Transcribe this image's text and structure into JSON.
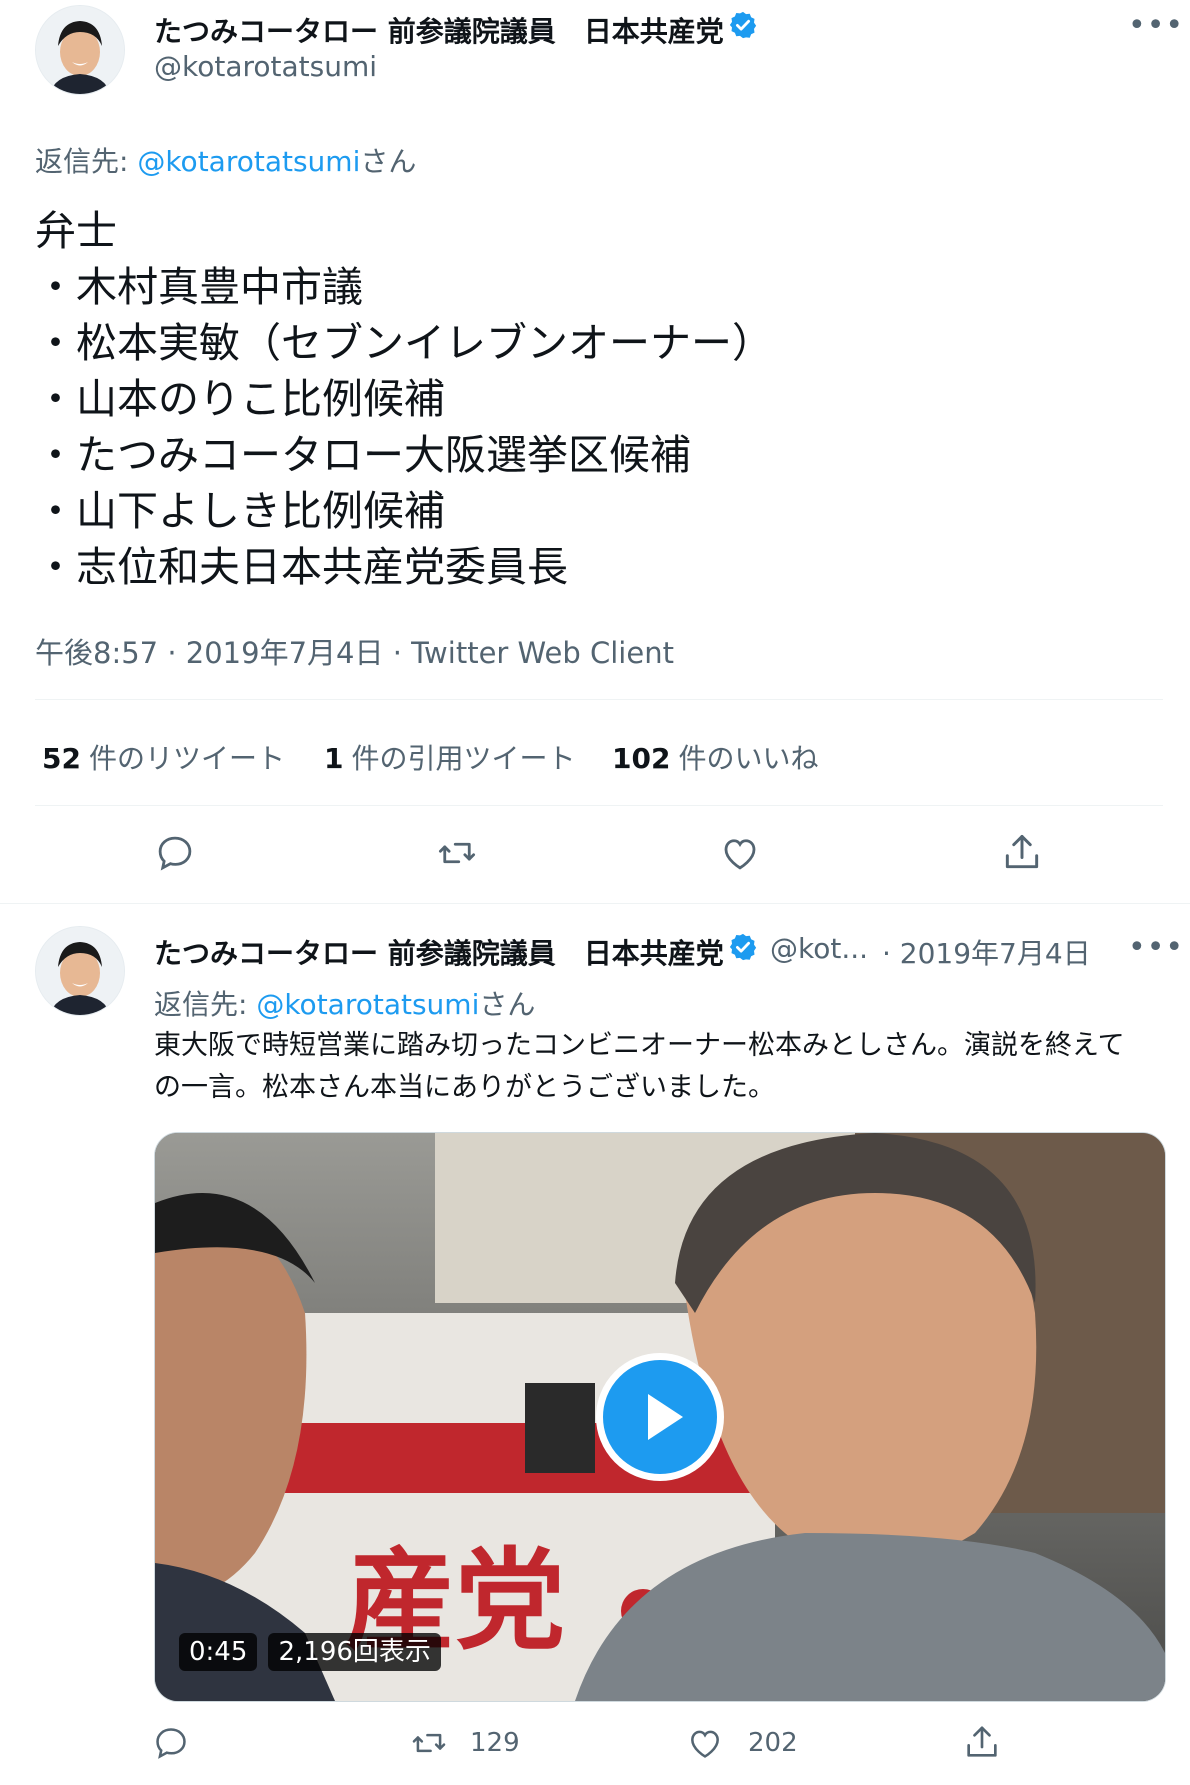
{
  "tweet1": {
    "display_name": "たつみコータロー 前参議院議員　日本共産党",
    "handle": "@kotarotatsumi",
    "more_icon": "more-icon",
    "reply_to_prefix": "返信先: ",
    "reply_to_user": "@kotarotatsumi",
    "reply_to_suffix": "さん",
    "body_lines": [
      "弁士",
      "・木村真豊中市議",
      "・松本実敏（セブンイレブンオーナー）",
      "・山本のりこ比例候補",
      "・たつみコータロー大阪選挙区候補",
      "・山下よしき比例候補",
      "・志位和夫日本共産党委員長"
    ],
    "timestamp": "午後8:57 · 2019年7月4日 · Twitter Web Client",
    "stats": {
      "retweets": {
        "count": "52",
        "label": "件のリツイート"
      },
      "quotes": {
        "count": "1",
        "label": "件の引用ツイート"
      },
      "likes": {
        "count": "102",
        "label": "件のいいね"
      }
    }
  },
  "tweet2": {
    "display_name": "たつみコータロー 前参議院議員　日本共産党",
    "handle_truncated": "@kot...",
    "date": "· 2019年7月4日",
    "reply_to_prefix": "返信先: ",
    "reply_to_user": "@kotarotatsumi",
    "reply_to_suffix": "さん",
    "text_line1": "東大阪で時短営業に踏み切ったコンビニオーナー松本みとしさん。演説を終えて",
    "text_line2": "の一言。松本さん本当にありがとうございました。",
    "video": {
      "duration": "0:45",
      "views": "2,196回表示",
      "banner_text": "産党"
    },
    "actions": {
      "retweets": "129",
      "likes": "202"
    }
  },
  "colors": {
    "accent": "#1d9bf0",
    "text_secondary": "#536471",
    "divider": "#eff3f4"
  }
}
